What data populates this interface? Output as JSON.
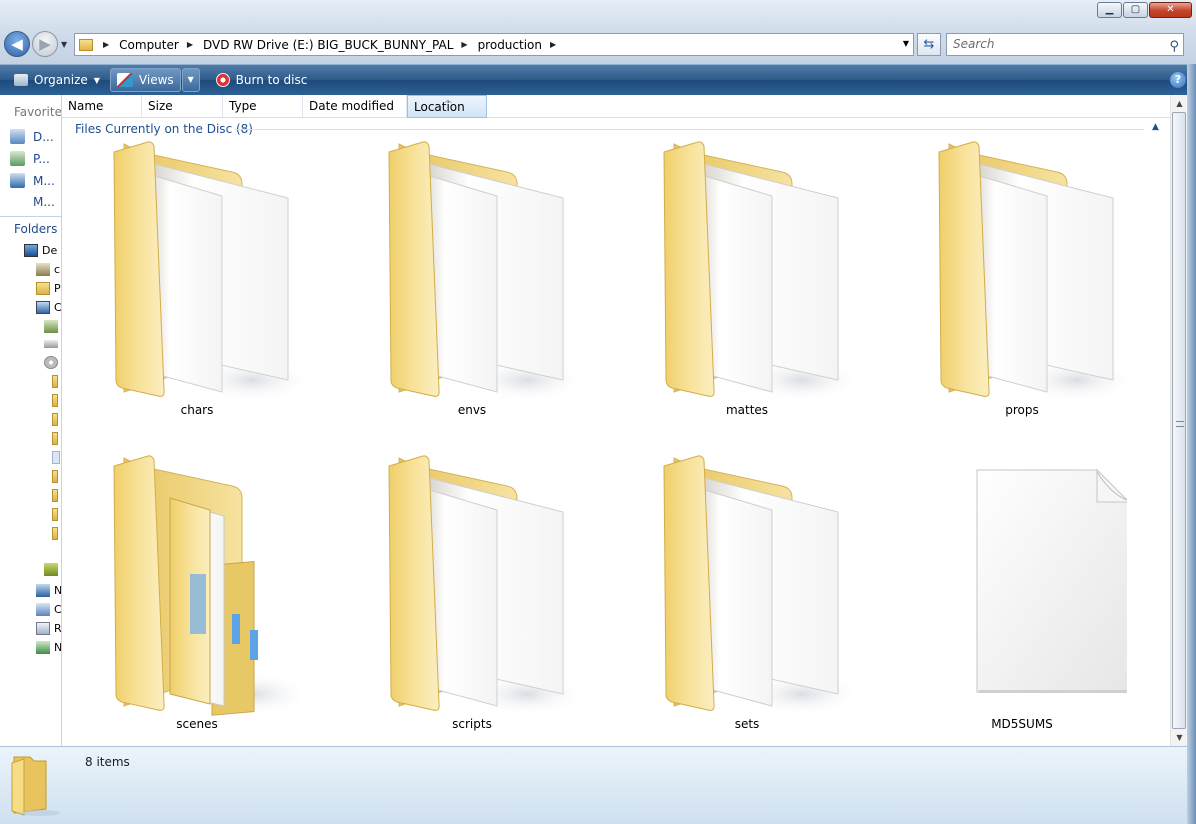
{
  "window": {
    "caption_buttons": [
      "minimize",
      "maximize",
      "close"
    ]
  },
  "address": {
    "segments": [
      "Computer",
      "DVD RW Drive (E:) BIG_BUCK_BUNNY_PAL",
      "production"
    ],
    "search_placeholder": "Search"
  },
  "toolbar": {
    "organize_label": "Organize",
    "views_label": "Views",
    "burn_label": "Burn to disc",
    "help_label": "?"
  },
  "nav_pane": {
    "favorites_label": "Favorite l",
    "links": [
      {
        "label": "D...",
        "icon": "documents-icon"
      },
      {
        "label": "P...",
        "icon": "pictures-icon"
      },
      {
        "label": "M...",
        "icon": "music-icon"
      },
      {
        "label": "M...",
        "icon": "more-icon"
      }
    ],
    "folders_label": "Folders",
    "tree": [
      {
        "label": "De",
        "icon": "desktop-icon"
      },
      {
        "label": "c",
        "icon": "user-icon"
      },
      {
        "label": "P",
        "icon": "folder-icon"
      },
      {
        "label": "C",
        "icon": "computer-icon"
      },
      {
        "label": "N",
        "icon": "network-icon"
      },
      {
        "label": "C",
        "icon": "control-panel-icon"
      },
      {
        "label": "R",
        "icon": "recycle-bin-icon"
      },
      {
        "label": "N",
        "icon": "home-icon"
      }
    ]
  },
  "columns": [
    "Name",
    "Size",
    "Type",
    "Date modified",
    "Location"
  ],
  "sorted_column": "Location",
  "group": {
    "title": "Files Currently on the Disc (8)"
  },
  "items": [
    {
      "name": "chars",
      "kind": "folder"
    },
    {
      "name": "envs",
      "kind": "folder"
    },
    {
      "name": "mattes",
      "kind": "folder"
    },
    {
      "name": "props",
      "kind": "folder"
    },
    {
      "name": "scenes",
      "kind": "folder-full"
    },
    {
      "name": "scripts",
      "kind": "folder"
    },
    {
      "name": "sets",
      "kind": "folder"
    },
    {
      "name": "MD5SUMS",
      "kind": "file"
    }
  ],
  "status": {
    "item_count": "8 items"
  },
  "colors": {
    "command_bar": "#2d5a8b",
    "group_header": "#1d4f91",
    "details_pane": "#dbe8f4",
    "folder": "#f3d67a"
  }
}
